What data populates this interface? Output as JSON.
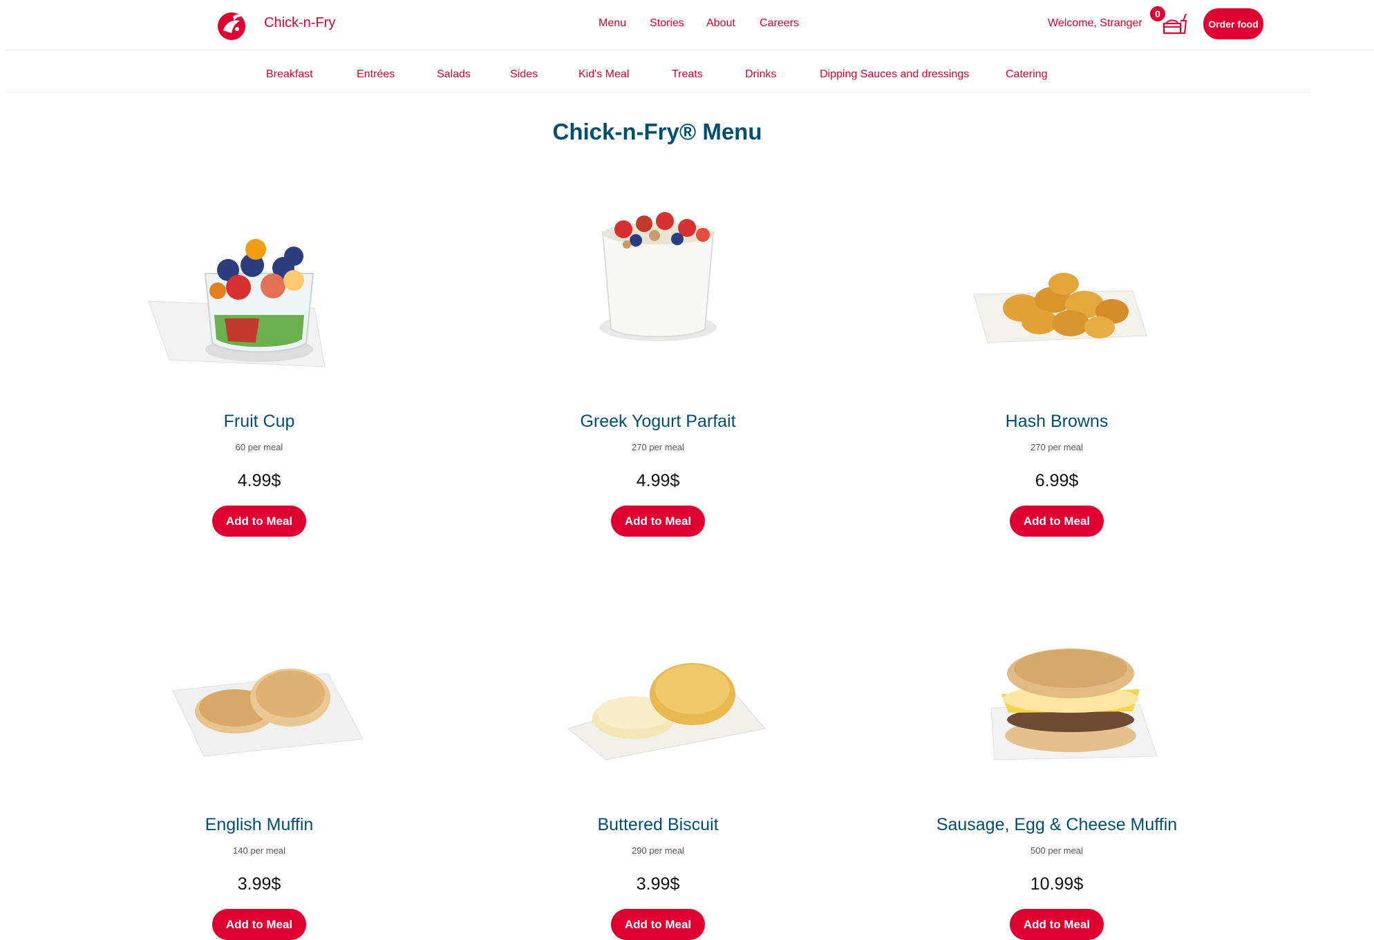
{
  "header": {
    "brand": "Chick-n-Fry",
    "nav": [
      "Menu",
      "Stories",
      "About",
      "Careers"
    ],
    "welcome": "Welcome, Stranger",
    "cart_count": "0",
    "order_button": "Order food"
  },
  "categories": [
    "Breakfast",
    "Entrées",
    "Salads",
    "Sides",
    "Kid's Meal",
    "Treats",
    "Drinks",
    "Dipping Sauces and dressings",
    "Catering"
  ],
  "page_title": "Chick-n-Fry® Menu",
  "products": [
    {
      "name": "Fruit Cup",
      "calories": "60 per meal",
      "price": "4.99$",
      "button": "Add to Meal",
      "icon": "fruit-cup-image"
    },
    {
      "name": "Greek Yogurt Parfait",
      "calories": "270 per meal",
      "price": "4.99$",
      "button": "Add to Meal",
      "icon": "yogurt-parfait-image"
    },
    {
      "name": "Hash Browns",
      "calories": "270 per meal",
      "price": "6.99$",
      "button": "Add to Meal",
      "icon": "hash-browns-image"
    },
    {
      "name": "English Muffin",
      "calories": "140 per meal",
      "price": "3.99$",
      "button": "Add to Meal",
      "icon": "english-muffin-image"
    },
    {
      "name": "Buttered Biscuit",
      "calories": "290 per meal",
      "price": "3.99$",
      "button": "Add to Meal",
      "icon": "buttered-biscuit-image"
    },
    {
      "name": "Sausage, Egg & Cheese Muffin",
      "calories": "500 per meal",
      "price": "10.99$",
      "button": "Add to Meal",
      "icon": "sausage-egg-cheese-muffin-image"
    }
  ],
  "colors": {
    "brand_red": "#dd0031",
    "title_blue": "#004f71"
  }
}
